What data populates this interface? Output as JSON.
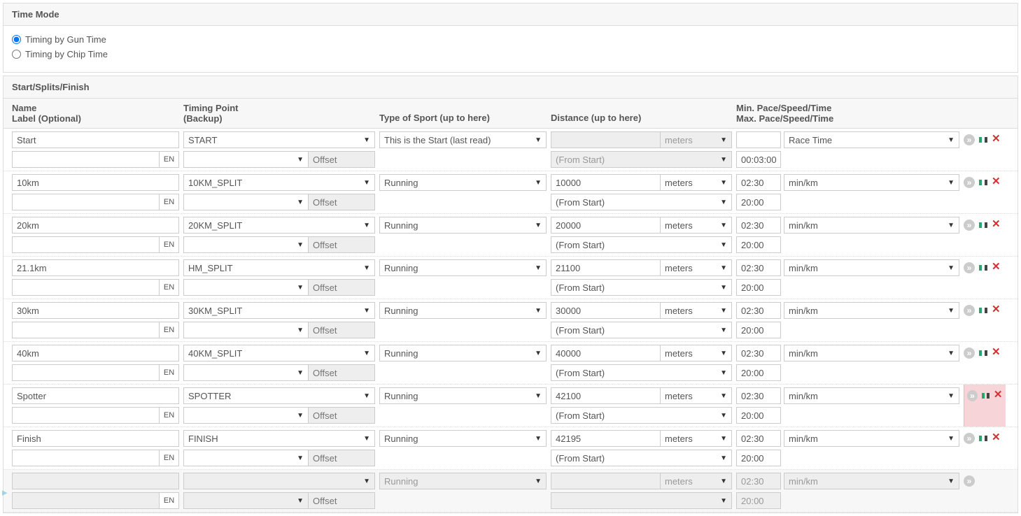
{
  "timeMode": {
    "title": "Time Mode",
    "options": [
      "Timing by Gun Time",
      "Timing by Chip Time"
    ],
    "selected": 0
  },
  "splitsSection": {
    "title": "Start/Splits/Finish",
    "columns": {
      "name_line1": "Name",
      "name_line2": "Label (Optional)",
      "tp_line1": "Timing Point",
      "tp_line2": "(Backup)",
      "sport": "Type of Sport (up to here)",
      "dist": "Distance (up to here)",
      "pace_line1": "Min. Pace/Speed/Time",
      "pace_line2": "Max. Pace/Speed/Time"
    },
    "langBtn": "EN",
    "offsetPlaceholder": "Offset",
    "rows": [
      {
        "name": "Start",
        "tp": "START",
        "sport": "This is the Start (last read)",
        "distance": "",
        "unit": "meters",
        "distDisabled": true,
        "from": "(From Start)",
        "fromDisabled": true,
        "minPace": "",
        "maxPace": "00:03:00",
        "paceUnit": "Race Time",
        "highlight": false
      },
      {
        "name": "10km",
        "tp": "10KM_SPLIT",
        "sport": "Running",
        "distance": "10000",
        "unit": "meters",
        "from": "(From Start)",
        "minPace": "02:30",
        "maxPace": "20:00",
        "paceUnit": "min/km",
        "highlight": false
      },
      {
        "name": "20km",
        "tp": "20KM_SPLIT",
        "sport": "Running",
        "distance": "20000",
        "unit": "meters",
        "from": "(From Start)",
        "minPace": "02:30",
        "maxPace": "20:00",
        "paceUnit": "min/km",
        "highlight": false
      },
      {
        "name": "21.1km",
        "tp": "HM_SPLIT",
        "sport": "Running",
        "distance": "21100",
        "unit": "meters",
        "from": "(From Start)",
        "minPace": "02:30",
        "maxPace": "20:00",
        "paceUnit": "min/km",
        "highlight": false
      },
      {
        "name": "30km",
        "tp": "30KM_SPLIT",
        "sport": "Running",
        "distance": "30000",
        "unit": "meters",
        "from": "(From Start)",
        "minPace": "02:30",
        "maxPace": "20:00",
        "paceUnit": "min/km",
        "highlight": false
      },
      {
        "name": "40km",
        "tp": "40KM_SPLIT",
        "sport": "Running",
        "distance": "40000",
        "unit": "meters",
        "from": "(From Start)",
        "minPace": "02:30",
        "maxPace": "20:00",
        "paceUnit": "min/km",
        "highlight": false
      },
      {
        "name": "Spotter",
        "tp": "SPOTTER",
        "sport": "Running",
        "distance": "42100",
        "unit": "meters",
        "from": "(From Start)",
        "minPace": "02:30",
        "maxPace": "20:00",
        "paceUnit": "min/km",
        "highlight": true
      },
      {
        "name": "Finish",
        "tp": "FINISH",
        "sport": "Running",
        "distance": "42195",
        "unit": "meters",
        "from": "(From Start)",
        "minPace": "02:30",
        "maxPace": "20:00",
        "paceUnit": "min/km",
        "highlight": false
      }
    ],
    "templateRow": {
      "sport": "Running",
      "unit": "meters",
      "minPace": "02:30",
      "maxPace": "20:00",
      "paceUnit": "min/km"
    }
  }
}
